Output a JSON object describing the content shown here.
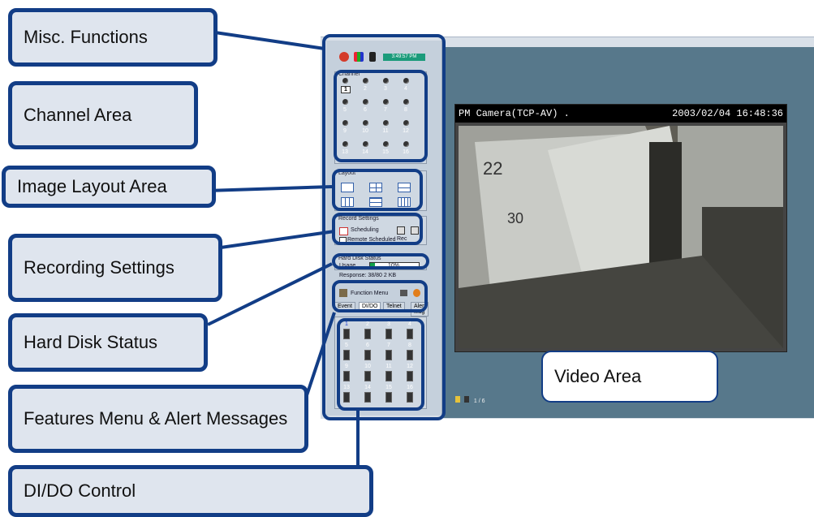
{
  "callouts": {
    "misc": "Misc. Functions",
    "channel": "Channel Area",
    "layout": "Image Layout Area",
    "recording": "Recording Settings",
    "harddisk": "Hard Disk Status",
    "features": "Features Menu & Alert Messages",
    "dido": "DI/DO Control",
    "video": "Video Area"
  },
  "video": {
    "camera_name": "PM Camera(TCP-AV) .",
    "timestamp": "2003/02/04 16:48:36"
  },
  "sidebar": {
    "time_display": "3:49:57 PM",
    "channel_label": "Channel",
    "channels": [
      "1",
      "2",
      "3",
      "4",
      "5",
      "6",
      "7",
      "8",
      "9",
      "10",
      "11",
      "12",
      "13",
      "14",
      "15",
      "16"
    ],
    "layout_label": "Layout",
    "record_label": "Record Settings",
    "scheduling_label": "Scheduling",
    "remote_label": "Remote Scheduled",
    "rec_label": "Rec",
    "hdd_label": "Hard Disk Status",
    "usage_label": "Usage",
    "usage_value": "10%",
    "usage_percent": 10,
    "response_label": "Response: 38/80  2 KB",
    "function_menu_label": "Function Menu",
    "tabs": [
      "Event",
      "DI/DO",
      "Telnet",
      "Alert Msg"
    ],
    "dido": [
      "1",
      "2",
      "3",
      "4",
      "5",
      "6",
      "7",
      "8",
      "9",
      "10",
      "11",
      "12",
      "13",
      "14",
      "15",
      "16"
    ]
  },
  "bottom_icons": "1 / 6",
  "accent_color": "#123d86"
}
